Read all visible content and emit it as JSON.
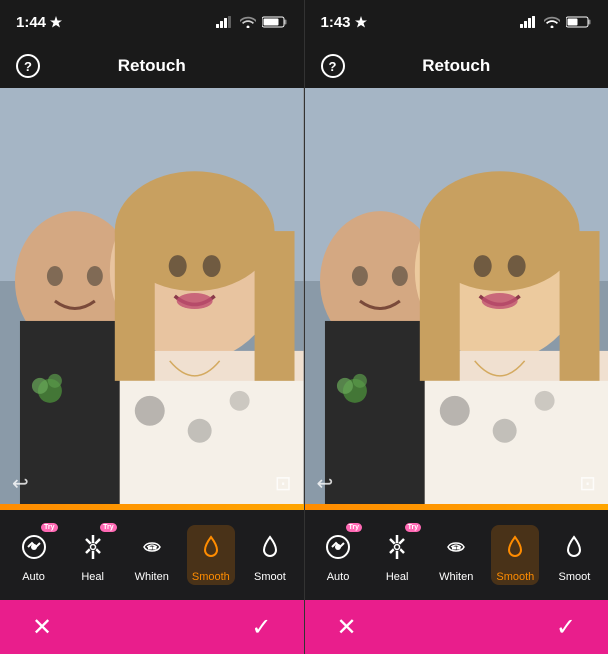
{
  "panels": [
    {
      "id": "left",
      "time": "1:44",
      "time_icon": "location-arrow",
      "title": "Retouch",
      "help_label": "?",
      "tools": [
        {
          "id": "auto",
          "label": "Auto",
          "icon": "auto",
          "has_try": true,
          "selected": false
        },
        {
          "id": "heal",
          "label": "Heal",
          "icon": "heal",
          "has_try": true,
          "selected": false
        },
        {
          "id": "whiten",
          "label": "Whiten",
          "icon": "whiten",
          "has_try": false,
          "selected": false
        },
        {
          "id": "smooth",
          "label": "Smooth",
          "icon": "smooth",
          "has_try": false,
          "selected": false
        },
        {
          "id": "smooth2",
          "label": "Smoot",
          "icon": "smooth2",
          "has_try": false,
          "selected": false
        }
      ],
      "action_cancel": "✕",
      "action_confirm": "✓",
      "selected_tool_index": 3
    },
    {
      "id": "right",
      "time": "1:43",
      "time_icon": "location-arrow",
      "title": "Retouch",
      "help_label": "?",
      "tools": [
        {
          "id": "auto",
          "label": "Auto",
          "icon": "auto",
          "has_try": true,
          "selected": false
        },
        {
          "id": "heal",
          "label": "Heal",
          "icon": "heal",
          "has_try": true,
          "selected": false
        },
        {
          "id": "whiten",
          "label": "Whiten",
          "icon": "whiten",
          "has_try": false,
          "selected": false
        },
        {
          "id": "smooth",
          "label": "Smooth",
          "icon": "smooth",
          "has_try": false,
          "selected": false
        },
        {
          "id": "smooth2",
          "label": "Smoot",
          "icon": "smooth2",
          "has_try": false,
          "selected": false
        }
      ],
      "action_cancel": "✕",
      "action_confirm": "✓",
      "selected_tool_index": 3
    }
  ]
}
